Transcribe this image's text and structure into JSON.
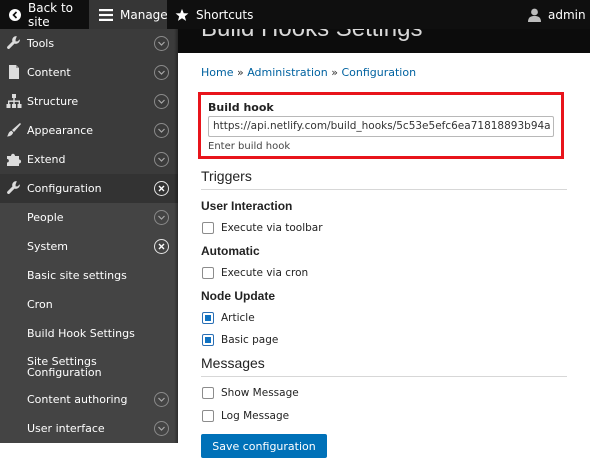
{
  "toolbar": {
    "back_label": "Back to site",
    "manage_label": "Manage",
    "shortcuts_label": "Shortcuts",
    "user_label": "admin"
  },
  "sidebar": {
    "items": [
      {
        "label": "Tools",
        "icon": "wrench-icon",
        "toggle": "expand"
      },
      {
        "label": "Content",
        "icon": "page-icon",
        "toggle": "expand"
      },
      {
        "label": "Structure",
        "icon": "sitemap-icon",
        "toggle": "expand"
      },
      {
        "label": "Appearance",
        "icon": "paintbrush-icon",
        "toggle": "expand"
      },
      {
        "label": "Extend",
        "icon": "puzzle-icon",
        "toggle": "expand"
      },
      {
        "label": "Configuration",
        "icon": "wrench-icon",
        "toggle": "collapse"
      },
      {
        "label": "People",
        "toggle": "expand"
      },
      {
        "label": "System",
        "toggle": "collapse"
      },
      {
        "label": "Basic site settings"
      },
      {
        "label": "Cron"
      },
      {
        "label": "Build Hook Settings"
      },
      {
        "label": "Site Settings Configuration"
      },
      {
        "label": "Content authoring",
        "toggle": "expand"
      },
      {
        "label": "User interface",
        "toggle": "expand"
      }
    ]
  },
  "page": {
    "title": "Build Hooks Settings",
    "breadcrumb": {
      "home": "Home",
      "sep": "»",
      "administration": "Administration",
      "configuration": "Configuration"
    },
    "build_hook": {
      "label": "Build hook",
      "value": "https://api.netlify.com/build_hooks/5c53e5efc6ea71818893b94a",
      "description": "Enter build hook"
    },
    "triggers_title": "Triggers",
    "user_interaction_title": "User Interaction",
    "execute_toolbar_label": "Execute via toolbar",
    "execute_toolbar_checked": false,
    "automatic_title": "Automatic",
    "execute_cron_label": "Execute via cron",
    "execute_cron_checked": false,
    "node_update_title": "Node Update",
    "article_label": "Article",
    "article_checked": true,
    "basic_page_label": "Basic page",
    "basic_page_checked": true,
    "messages_title": "Messages",
    "show_message_label": "Show Message",
    "show_message_checked": false,
    "log_message_label": "Log Message",
    "log_message_checked": false,
    "save_label": "Save configuration"
  },
  "colors": {
    "accent": "#0071b8",
    "link": "#0062a0",
    "highlight_box": "#e8141b",
    "sidebar_bg": "#3b3b3b",
    "toolbar_bg": "#0f0f0f"
  }
}
